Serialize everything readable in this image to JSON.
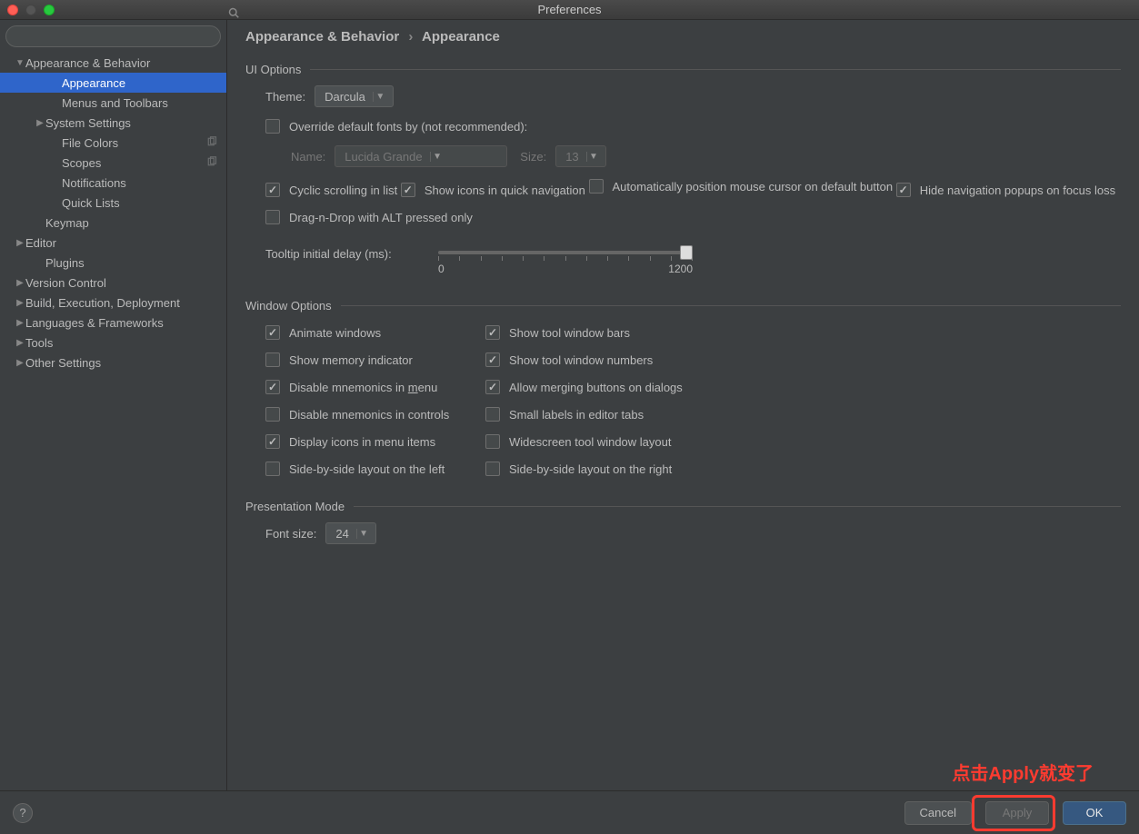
{
  "window": {
    "title": "Preferences"
  },
  "search": {
    "placeholder": ""
  },
  "sidebar": {
    "items": [
      {
        "label": "Appearance & Behavior",
        "indent": 0,
        "arrow": "down",
        "selected": false
      },
      {
        "label": "Appearance",
        "indent": 2,
        "arrow": "",
        "selected": true
      },
      {
        "label": "Menus and Toolbars",
        "indent": 2,
        "arrow": "",
        "selected": false
      },
      {
        "label": "System Settings",
        "indent": 1,
        "arrow": "right",
        "selected": false
      },
      {
        "label": "File Colors",
        "indent": 2,
        "arrow": "",
        "selected": false,
        "copy": true
      },
      {
        "label": "Scopes",
        "indent": 2,
        "arrow": "",
        "selected": false,
        "copy": true
      },
      {
        "label": "Notifications",
        "indent": 2,
        "arrow": "",
        "selected": false
      },
      {
        "label": "Quick Lists",
        "indent": 2,
        "arrow": "",
        "selected": false
      },
      {
        "label": "Keymap",
        "indent": 1,
        "arrow": "",
        "selected": false
      },
      {
        "label": "Editor",
        "indent": 0,
        "arrow": "right",
        "selected": false
      },
      {
        "label": "Plugins",
        "indent": 1,
        "arrow": "",
        "selected": false
      },
      {
        "label": "Version Control",
        "indent": 0,
        "arrow": "right",
        "selected": false
      },
      {
        "label": "Build, Execution, Deployment",
        "indent": 0,
        "arrow": "right",
        "selected": false
      },
      {
        "label": "Languages & Frameworks",
        "indent": 0,
        "arrow": "right",
        "selected": false
      },
      {
        "label": "Tools",
        "indent": 0,
        "arrow": "right",
        "selected": false
      },
      {
        "label": "Other Settings",
        "indent": 0,
        "arrow": "right",
        "selected": false
      }
    ]
  },
  "breadcrumb": {
    "parent": "Appearance & Behavior",
    "sep": "›",
    "current": "Appearance"
  },
  "ui_options": {
    "header": "UI Options",
    "theme_label": "Theme:",
    "theme_value": "Darcula",
    "override_fonts": {
      "label": "Override default fonts by (not recommended):",
      "checked": false
    },
    "font_name_label": "Name:",
    "font_name_value": "Lucida Grande",
    "font_size_label": "Size:",
    "font_size_value": "13",
    "cyclic": {
      "label": "Cyclic scrolling in list",
      "checked": true
    },
    "quick_nav_icons": {
      "label": "Show icons in quick navigation",
      "checked": true
    },
    "auto_cursor": {
      "label": "Automatically position mouse cursor on default button",
      "checked": false
    },
    "hide_nav": {
      "label": "Hide navigation popups on focus loss",
      "checked": true
    },
    "dnd_alt": {
      "label": "Drag-n-Drop with ALT pressed only",
      "checked": false
    },
    "tooltip_label": "Tooltip initial delay (ms):",
    "tooltip_min": "0",
    "tooltip_max": "1200"
  },
  "window_options": {
    "header": "Window Options",
    "left": [
      {
        "label": "Animate windows",
        "checked": true
      },
      {
        "label": "Show memory indicator",
        "checked": false
      },
      {
        "label_pre": "Disable mnemonics in ",
        "label_u": "m",
        "label_post": "enu",
        "checked": true
      },
      {
        "label": "Disable mnemonics in controls",
        "checked": false
      },
      {
        "label": "Display icons in menu items",
        "checked": true
      },
      {
        "label": "Side-by-side layout on the left",
        "checked": false
      }
    ],
    "right": [
      {
        "label": "Show tool window bars",
        "checked": true
      },
      {
        "label": "Show tool window numbers",
        "checked": true
      },
      {
        "label": "Allow merging buttons on dialogs",
        "checked": true
      },
      {
        "label": "Small labels in editor tabs",
        "checked": false
      },
      {
        "label": "Widescreen tool window layout",
        "checked": false
      },
      {
        "label": "Side-by-side layout on the right",
        "checked": false
      }
    ]
  },
  "presentation": {
    "header": "Presentation Mode",
    "font_size_label": "Font size:",
    "font_size_value": "24"
  },
  "footer": {
    "help": "?",
    "cancel": "Cancel",
    "apply": "Apply",
    "ok": "OK"
  },
  "annotation": "点击Apply就变了"
}
